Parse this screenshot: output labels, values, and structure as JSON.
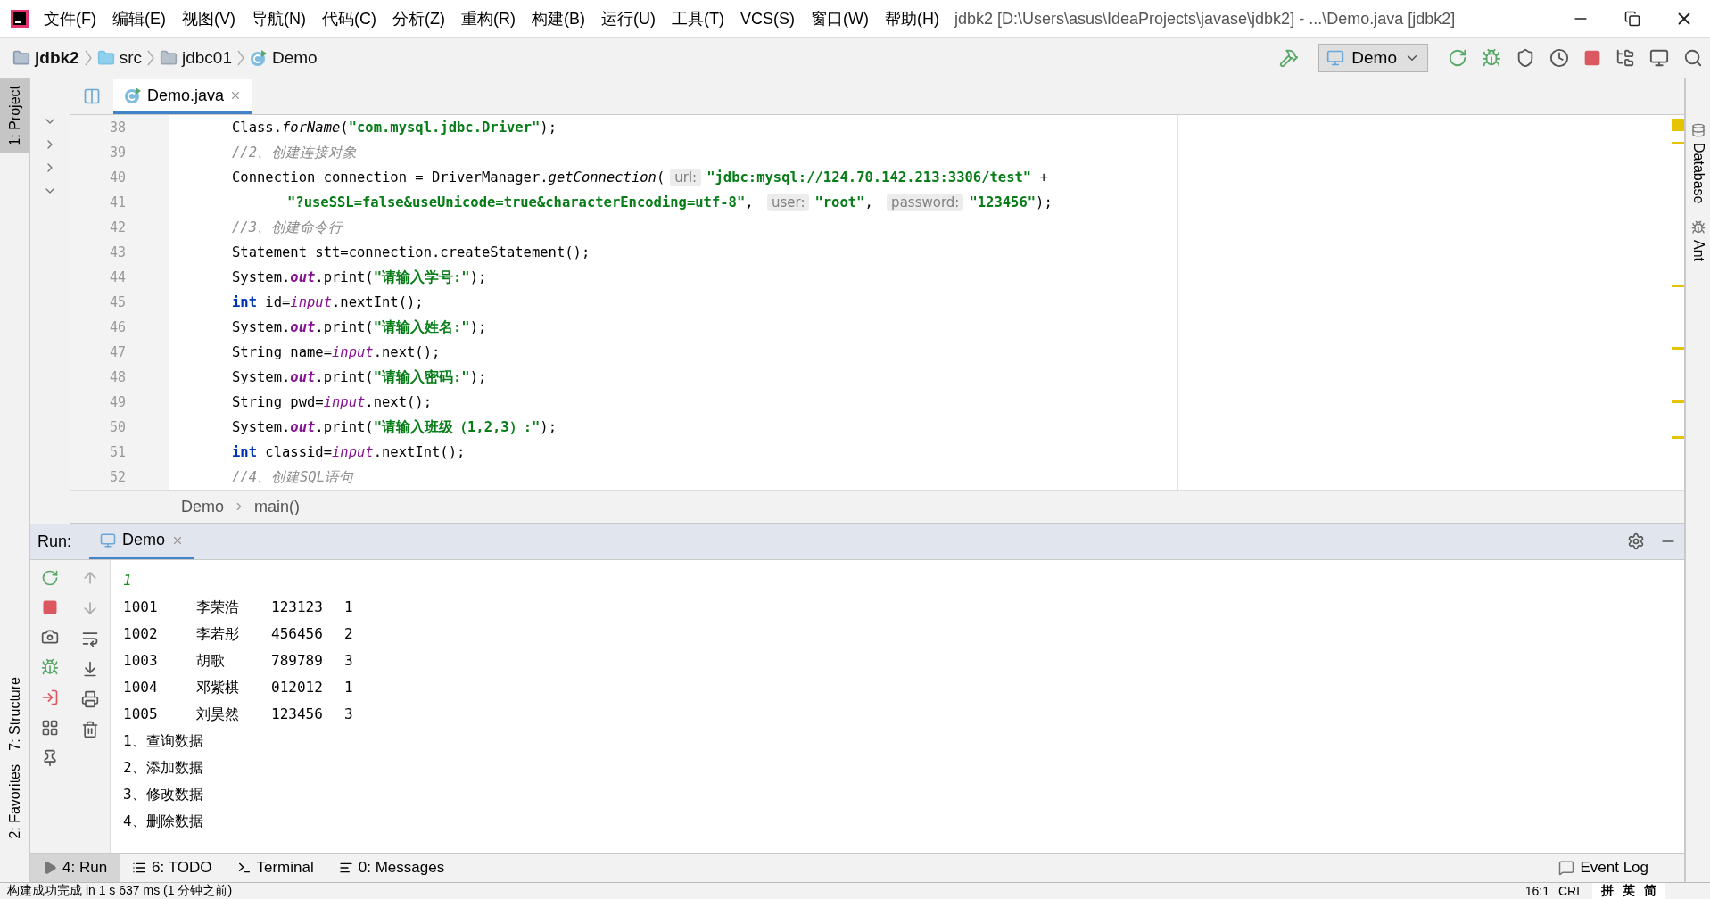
{
  "window": {
    "title": "jdbk2 [D:\\Users\\asus\\IdeaProjects\\javase\\jdbk2] - ...\\Demo.java [jdbk2]"
  },
  "menu": [
    "文件(F)",
    "编辑(E)",
    "视图(V)",
    "导航(N)",
    "代码(C)",
    "分析(Z)",
    "重构(R)",
    "构建(B)",
    "运行(U)",
    "工具(T)",
    "VCS(S)",
    "窗口(W)",
    "帮助(H)"
  ],
  "breadcrumb": [
    {
      "label": "jdbk2",
      "kind": "project"
    },
    {
      "label": "src",
      "kind": "folder"
    },
    {
      "label": "jdbc01",
      "kind": "package"
    },
    {
      "label": "Demo",
      "kind": "class"
    }
  ],
  "run_config": "Demo",
  "left_tool_tabs": [
    {
      "label": "1: Project",
      "selected": true
    },
    {
      "label": "7: Structure",
      "selected": false
    },
    {
      "label": "2: Favorites",
      "selected": false
    }
  ],
  "right_tool_tabs": [
    "Database",
    "Ant"
  ],
  "editor_tabs": [
    {
      "label": "Demo.java",
      "selected": true
    }
  ],
  "code_lines": [
    {
      "number": "38",
      "continuation": false,
      "tokens": [
        {
          "t": "Class.",
          "kind": "plain"
        },
        {
          "t": "forName",
          "kind": "call"
        },
        {
          "t": "(",
          "kind": "plain"
        },
        {
          "t": "\"com.mysql.jdbc.Driver\"",
          "kind": "string"
        },
        {
          "t": ");",
          "kind": "plain"
        }
      ]
    },
    {
      "number": "39",
      "continuation": false,
      "tokens": [
        {
          "t": "//2、创建连接对象",
          "kind": "comment"
        }
      ]
    },
    {
      "number": "40",
      "continuation": false,
      "tokens": [
        {
          "t": "Connection connection = DriverManager.",
          "kind": "plain"
        },
        {
          "t": "getConnection",
          "kind": "call"
        },
        {
          "t": "(",
          "kind": "plain"
        },
        {
          "t": "url:",
          "kind": "hint"
        },
        {
          "t": "\"jdbc:mysql://124.70.142.213:3306/test\"",
          "kind": "string"
        },
        {
          "t": " +",
          "kind": "plain"
        }
      ]
    },
    {
      "number": "41",
      "continuation": true,
      "tokens": [
        {
          "t": "\"?useSSL=false&useUnicode=true&characterEncoding=utf-8\"",
          "kind": "string"
        },
        {
          "t": ", ",
          "kind": "plain"
        },
        {
          "t": "user:",
          "kind": "hint"
        },
        {
          "t": "\"root\"",
          "kind": "string"
        },
        {
          "t": ", ",
          "kind": "plain"
        },
        {
          "t": "password:",
          "kind": "hint"
        },
        {
          "t": "\"123456\"",
          "kind": "string"
        },
        {
          "t": ");",
          "kind": "plain"
        }
      ]
    },
    {
      "number": "42",
      "continuation": false,
      "tokens": [
        {
          "t": "//3、创建命令行",
          "kind": "comment"
        }
      ]
    },
    {
      "number": "43",
      "continuation": false,
      "tokens": [
        {
          "t": "Statement stt=connection.createStatement();",
          "kind": "plain"
        }
      ]
    },
    {
      "number": "44",
      "continuation": false,
      "tokens": [
        {
          "t": "System.",
          "kind": "plain"
        },
        {
          "t": "out",
          "kind": "field"
        },
        {
          "t": ".print(",
          "kind": "plain"
        },
        {
          "t": "\"请输入学号:\"",
          "kind": "string"
        },
        {
          "t": ");",
          "kind": "plain"
        }
      ]
    },
    {
      "number": "45",
      "continuation": false,
      "tokens": [
        {
          "t": "int",
          "kind": "keyword"
        },
        {
          "t": " id=",
          "kind": "plain"
        },
        {
          "t": "input",
          "kind": "var"
        },
        {
          "t": ".nextInt();",
          "kind": "plain"
        }
      ]
    },
    {
      "number": "46",
      "continuation": false,
      "tokens": [
        {
          "t": "System.",
          "kind": "plain"
        },
        {
          "t": "out",
          "kind": "field"
        },
        {
          "t": ".print(",
          "kind": "plain"
        },
        {
          "t": "\"请输入姓名:\"",
          "kind": "string"
        },
        {
          "t": ");",
          "kind": "plain"
        }
      ]
    },
    {
      "number": "47",
      "continuation": false,
      "tokens": [
        {
          "t": "String name=",
          "kind": "plain"
        },
        {
          "t": "input",
          "kind": "var"
        },
        {
          "t": ".next();",
          "kind": "plain"
        }
      ]
    },
    {
      "number": "48",
      "continuation": false,
      "tokens": [
        {
          "t": "System.",
          "kind": "plain"
        },
        {
          "t": "out",
          "kind": "field"
        },
        {
          "t": ".print(",
          "kind": "plain"
        },
        {
          "t": "\"请输入密码:\"",
          "kind": "string"
        },
        {
          "t": ");",
          "kind": "plain"
        }
      ]
    },
    {
      "number": "49",
      "continuation": false,
      "tokens": [
        {
          "t": "String pwd=",
          "kind": "plain"
        },
        {
          "t": "input",
          "kind": "var"
        },
        {
          "t": ".next();",
          "kind": "plain"
        }
      ]
    },
    {
      "number": "50",
      "continuation": false,
      "tokens": [
        {
          "t": "System.",
          "kind": "plain"
        },
        {
          "t": "out",
          "kind": "field"
        },
        {
          "t": ".print(",
          "kind": "plain"
        },
        {
          "t": "\"请输入班级（1,2,3）:\"",
          "kind": "string"
        },
        {
          "t": ");",
          "kind": "plain"
        }
      ]
    },
    {
      "number": "51",
      "continuation": false,
      "tokens": [
        {
          "t": "int",
          "kind": "keyword"
        },
        {
          "t": " classid=",
          "kind": "plain"
        },
        {
          "t": "input",
          "kind": "var"
        },
        {
          "t": ".nextInt();",
          "kind": "plain"
        }
      ]
    },
    {
      "number": "52",
      "continuation": false,
      "tokens": [
        {
          "t": "//4、创建SQL语句",
          "kind": "comment"
        }
      ]
    }
  ],
  "editor_breadcrumb": [
    "Demo",
    "main()"
  ],
  "run_panel": {
    "label": "Run:",
    "tabs": [
      {
        "label": "Demo",
        "selected": true
      }
    ],
    "output": [
      {
        "kind": "input",
        "text": "1"
      },
      {
        "kind": "row",
        "cells": [
          "1001",
          "李荣浩",
          "123123",
          "1"
        ]
      },
      {
        "kind": "row",
        "cells": [
          "1002",
          "李若彤",
          "456456",
          "2"
        ]
      },
      {
        "kind": "row",
        "cells": [
          "1003",
          "胡歌",
          "789789",
          "3"
        ]
      },
      {
        "kind": "row",
        "cells": [
          "1004",
          "邓紫棋",
          "012012",
          "1"
        ]
      },
      {
        "kind": "row",
        "cells": [
          "1005",
          "刘昊然",
          "123456",
          "3"
        ]
      },
      {
        "kind": "line",
        "text": "1、查询数据"
      },
      {
        "kind": "line",
        "text": "2、添加数据"
      },
      {
        "kind": "line",
        "text": "3、修改数据"
      },
      {
        "kind": "line",
        "text": "4、删除数据"
      }
    ]
  },
  "bottom_tabs": [
    {
      "label": "4: Run",
      "kind": "run",
      "selected": true
    },
    {
      "label": "6: TODO",
      "kind": "todo",
      "selected": false
    },
    {
      "label": "Terminal",
      "kind": "terminal",
      "selected": false
    },
    {
      "label": "0: Messages",
      "kind": "messages",
      "selected": false
    }
  ],
  "event_log": "Event Log",
  "status_bar": {
    "message": "构建成功完成 in 1 s 637 ms (1 分钟之前)",
    "position": "16:1",
    "line_separator": "CRL"
  },
  "ime_toolbar": [
    "拼",
    "英",
    "简"
  ]
}
